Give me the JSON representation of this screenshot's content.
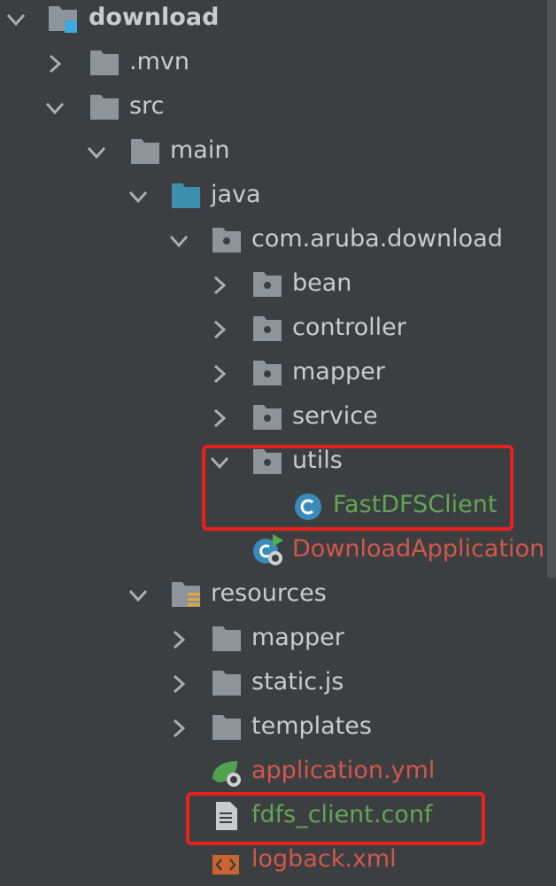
{
  "tree": {
    "root": {
      "label": "download",
      "expanded": true,
      "icon": "module-folder-icon"
    },
    "items": [
      {
        "label": ".mvn",
        "expanded": false,
        "icon": "folder-icon"
      },
      {
        "label": "src",
        "expanded": true,
        "icon": "folder-icon"
      },
      {
        "label": "main",
        "expanded": true,
        "icon": "folder-icon"
      },
      {
        "label": "java",
        "expanded": true,
        "icon": "source-root-folder-icon"
      },
      {
        "label": "com.aruba.download",
        "expanded": true,
        "icon": "package-icon"
      },
      {
        "label": "bean",
        "expanded": false,
        "icon": "package-icon"
      },
      {
        "label": "controller",
        "expanded": false,
        "icon": "package-icon"
      },
      {
        "label": "mapper",
        "expanded": false,
        "icon": "package-icon"
      },
      {
        "label": "service",
        "expanded": false,
        "icon": "package-icon"
      },
      {
        "label": "utils",
        "expanded": true,
        "icon": "package-icon"
      },
      {
        "label": "FastDFSClient",
        "icon": "class-icon",
        "vcs_status": "added"
      },
      {
        "label": "DownloadApplication",
        "icon": "spring-boot-class-icon",
        "vcs_status": "modified-red"
      },
      {
        "label": "resources",
        "expanded": true,
        "icon": "resources-root-folder-icon"
      },
      {
        "label": "mapper",
        "expanded": false,
        "icon": "folder-icon"
      },
      {
        "label": "static.js",
        "expanded": false,
        "icon": "folder-icon"
      },
      {
        "label": "templates",
        "expanded": false,
        "icon": "folder-icon"
      },
      {
        "label": "application.yml",
        "icon": "spring-yml-icon",
        "vcs_status": "modified-red"
      },
      {
        "label": "fdfs_client.conf",
        "icon": "text-file-icon",
        "vcs_status": "added"
      },
      {
        "label": "logback.xml",
        "icon": "xml-file-icon",
        "vcs_status": "modified-red"
      }
    ]
  },
  "colors": {
    "background": "#3c3f41",
    "text": "#c9ccce",
    "vcs_added": "#62a554",
    "vcs_unversioned": "#d2574a",
    "highlight_box": "#e8211c",
    "folder": "#8f9499",
    "source_folder": "#3d8fb0"
  }
}
